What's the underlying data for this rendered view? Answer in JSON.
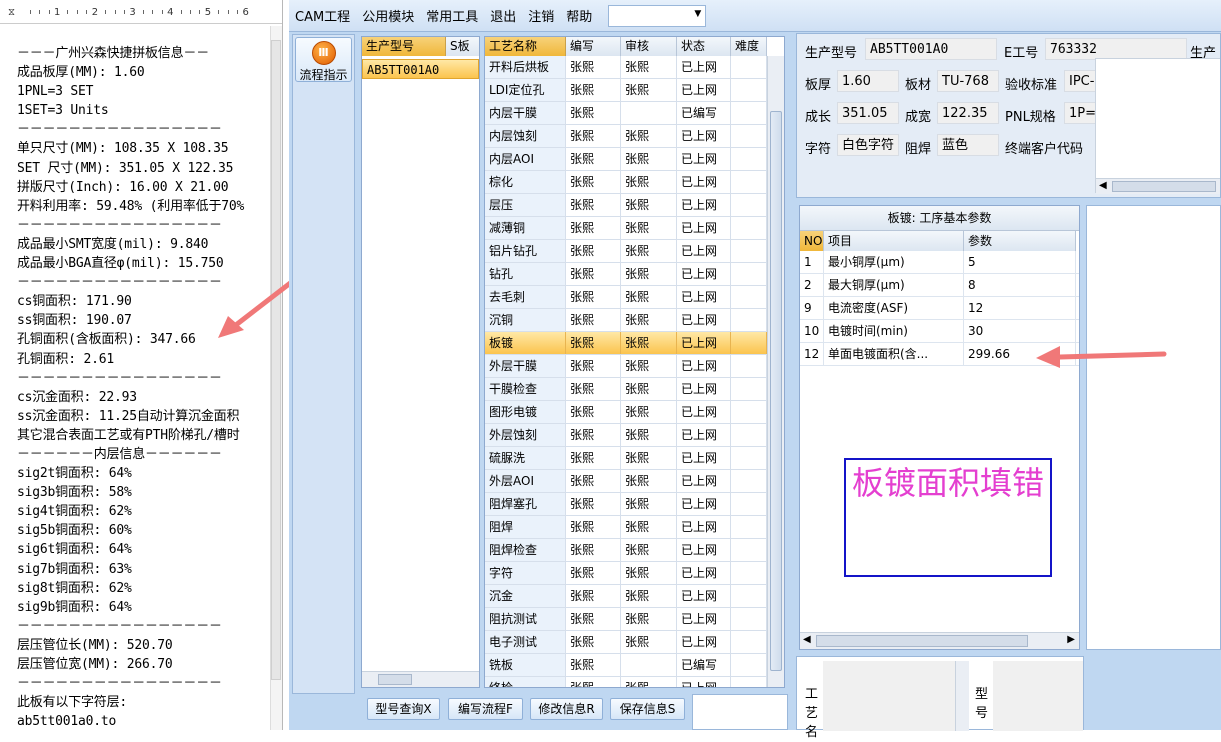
{
  "ruler": {
    "marks": [
      "1",
      "2",
      "3",
      "4",
      "5",
      "6"
    ]
  },
  "document": {
    "lines": [
      "－－－广州兴森快捷拼板信息－－",
      "成品板厚(MM): 1.60",
      "1PNL=3 SET",
      "1SET=3 Units",
      "－－－－－－－－－－－－－－－－",
      "单只尺寸(MM): 108.35 X 108.35",
      "SET 尺寸(MM): 351.05 X 122.35",
      "拼版尺寸(Inch): 16.00 X 21.00",
      "开料利用率: 59.48% (利用率低于70%",
      "－－－－－－－－－－－－－－－－",
      "成品最小SMT宽度(mil): 9.840",
      "成品最小BGA直径φ(mil): 15.750",
      "－－－－－－－－－－－－－－－－",
      "cs铜面积: 171.90",
      "ss铜面积: 190.07",
      "孔铜面积(含板面积): 347.66",
      "孔铜面积: 2.61",
      "－－－－－－－－－－－－－－－－",
      "cs沉金面积: 22.93",
      "ss沉金面积: 11.25自动计算沉金面积",
      "其它混合表面工艺或有PTH阶梯孔/槽时",
      "－－－－－－内层信息－－－－－－",
      "sig2t铜面积: 64%",
      "sig3b铜面积: 58%",
      "sig4t铜面积: 62%",
      "sig5b铜面积: 60%",
      "sig6t铜面积: 64%",
      "sig7b铜面积: 63%",
      "sig8t铜面积: 62%",
      "sig9b铜面积: 64%",
      "－－－－－－－－－－－－－－－－",
      "层压管位长(MM): 520.70",
      "层压管位宽(MM): 266.70",
      "－－－－－－－－－－－－－－－－",
      "此板有以下字符层:",
      "ab5tt001a0.to"
    ]
  },
  "menu": {
    "items": [
      "CAM工程",
      "公用模块",
      "常用工具",
      "退出",
      "注销",
      "帮助"
    ]
  },
  "flow": {
    "label": "流程指示"
  },
  "models": {
    "headers": [
      "生产型号",
      "S板"
    ],
    "rows": [
      "AB5TT001A0"
    ]
  },
  "process": {
    "headers": [
      "工艺名称",
      "编写",
      "审核",
      "状态",
      "难度"
    ],
    "rows": [
      [
        "开料后烘板",
        "张熙",
        "张熙",
        "已上网"
      ],
      [
        "LDI定位孔",
        "张熙",
        "张熙",
        "已上网"
      ],
      [
        "内层干膜",
        "张熙",
        "",
        "已编写"
      ],
      [
        "内层蚀刻",
        "张熙",
        "张熙",
        "已上网"
      ],
      [
        "内层AOI",
        "张熙",
        "张熙",
        "已上网"
      ],
      [
        "棕化",
        "张熙",
        "张熙",
        "已上网"
      ],
      [
        "层压",
        "张熙",
        "张熙",
        "已上网"
      ],
      [
        "减薄铜",
        "张熙",
        "张熙",
        "已上网"
      ],
      [
        "铝片钻孔",
        "张熙",
        "张熙",
        "已上网"
      ],
      [
        "钻孔",
        "张熙",
        "张熙",
        "已上网"
      ],
      [
        "去毛刺",
        "张熙",
        "张熙",
        "已上网"
      ],
      [
        "沉铜",
        "张熙",
        "张熙",
        "已上网"
      ],
      [
        "板镀",
        "张熙",
        "张熙",
        "已上网"
      ],
      [
        "外层干膜",
        "张熙",
        "张熙",
        "已上网"
      ],
      [
        "干膜检查",
        "张熙",
        "张熙",
        "已上网"
      ],
      [
        "图形电镀",
        "张熙",
        "张熙",
        "已上网"
      ],
      [
        "外层蚀刻",
        "张熙",
        "张熙",
        "已上网"
      ],
      [
        "硫脲洗",
        "张熙",
        "张熙",
        "已上网"
      ],
      [
        "外层AOI",
        "张熙",
        "张熙",
        "已上网"
      ],
      [
        "阻焊塞孔",
        "张熙",
        "张熙",
        "已上网"
      ],
      [
        "阻焊",
        "张熙",
        "张熙",
        "已上网"
      ],
      [
        "阻焊检查",
        "张熙",
        "张熙",
        "已上网"
      ],
      [
        "字符",
        "张熙",
        "张熙",
        "已上网"
      ],
      [
        "沉金",
        "张熙",
        "张熙",
        "已上网"
      ],
      [
        "阻抗测试",
        "张熙",
        "张熙",
        "已上网"
      ],
      [
        "电子测试",
        "张熙",
        "张熙",
        "已上网"
      ],
      [
        "铣板",
        "张熙",
        "",
        "已编写"
      ],
      [
        "终检",
        "张熙",
        "张熙",
        "已上网"
      ]
    ],
    "selected_index": 12
  },
  "buttons": [
    "型号查询X",
    "编写流程F",
    "修改信息R",
    "保存信息S"
  ],
  "info": {
    "labels": [
      "生产型号",
      "E工号",
      "生产型号",
      "板厚",
      "板材",
      "验收标准",
      "成长",
      "成宽",
      "PNL规格",
      "字符",
      "阻焊",
      "终端客户代码"
    ],
    "values": {
      "model": "AB5TT001A0",
      "e_no": "763332",
      "thickness": "1.60",
      "material": "TU-768",
      "standard": "IPC-",
      "length": "351.05",
      "width": "122.35",
      "pnl": "1P=",
      "silkscreen": "白色字符",
      "soldermask": "蓝色"
    }
  },
  "params": {
    "title": "板镀: 工序基本参数",
    "headers": [
      "NO",
      "项目",
      "参数"
    ],
    "rows": [
      [
        "1",
        "最小铜厚(μm)",
        "5"
      ],
      [
        "2",
        "最大铜厚(μm)",
        "8"
      ],
      [
        "9",
        "电流密度(ASF)",
        "12"
      ],
      [
        "10",
        "电镀时间(min)",
        "30"
      ],
      [
        "12",
        "单面电镀面积(含...",
        "299.66"
      ]
    ]
  },
  "annotation": {
    "text": "板镀面积填错",
    "color": "#e43fd0",
    "border": "#1414c8"
  },
  "bottom_right": {
    "labels": [
      "工艺名",
      "型号"
    ]
  },
  "colors": {
    "arrow": "#f07878",
    "header_gold": "#f0b73a",
    "panel_blue": "#bfd7f1"
  }
}
